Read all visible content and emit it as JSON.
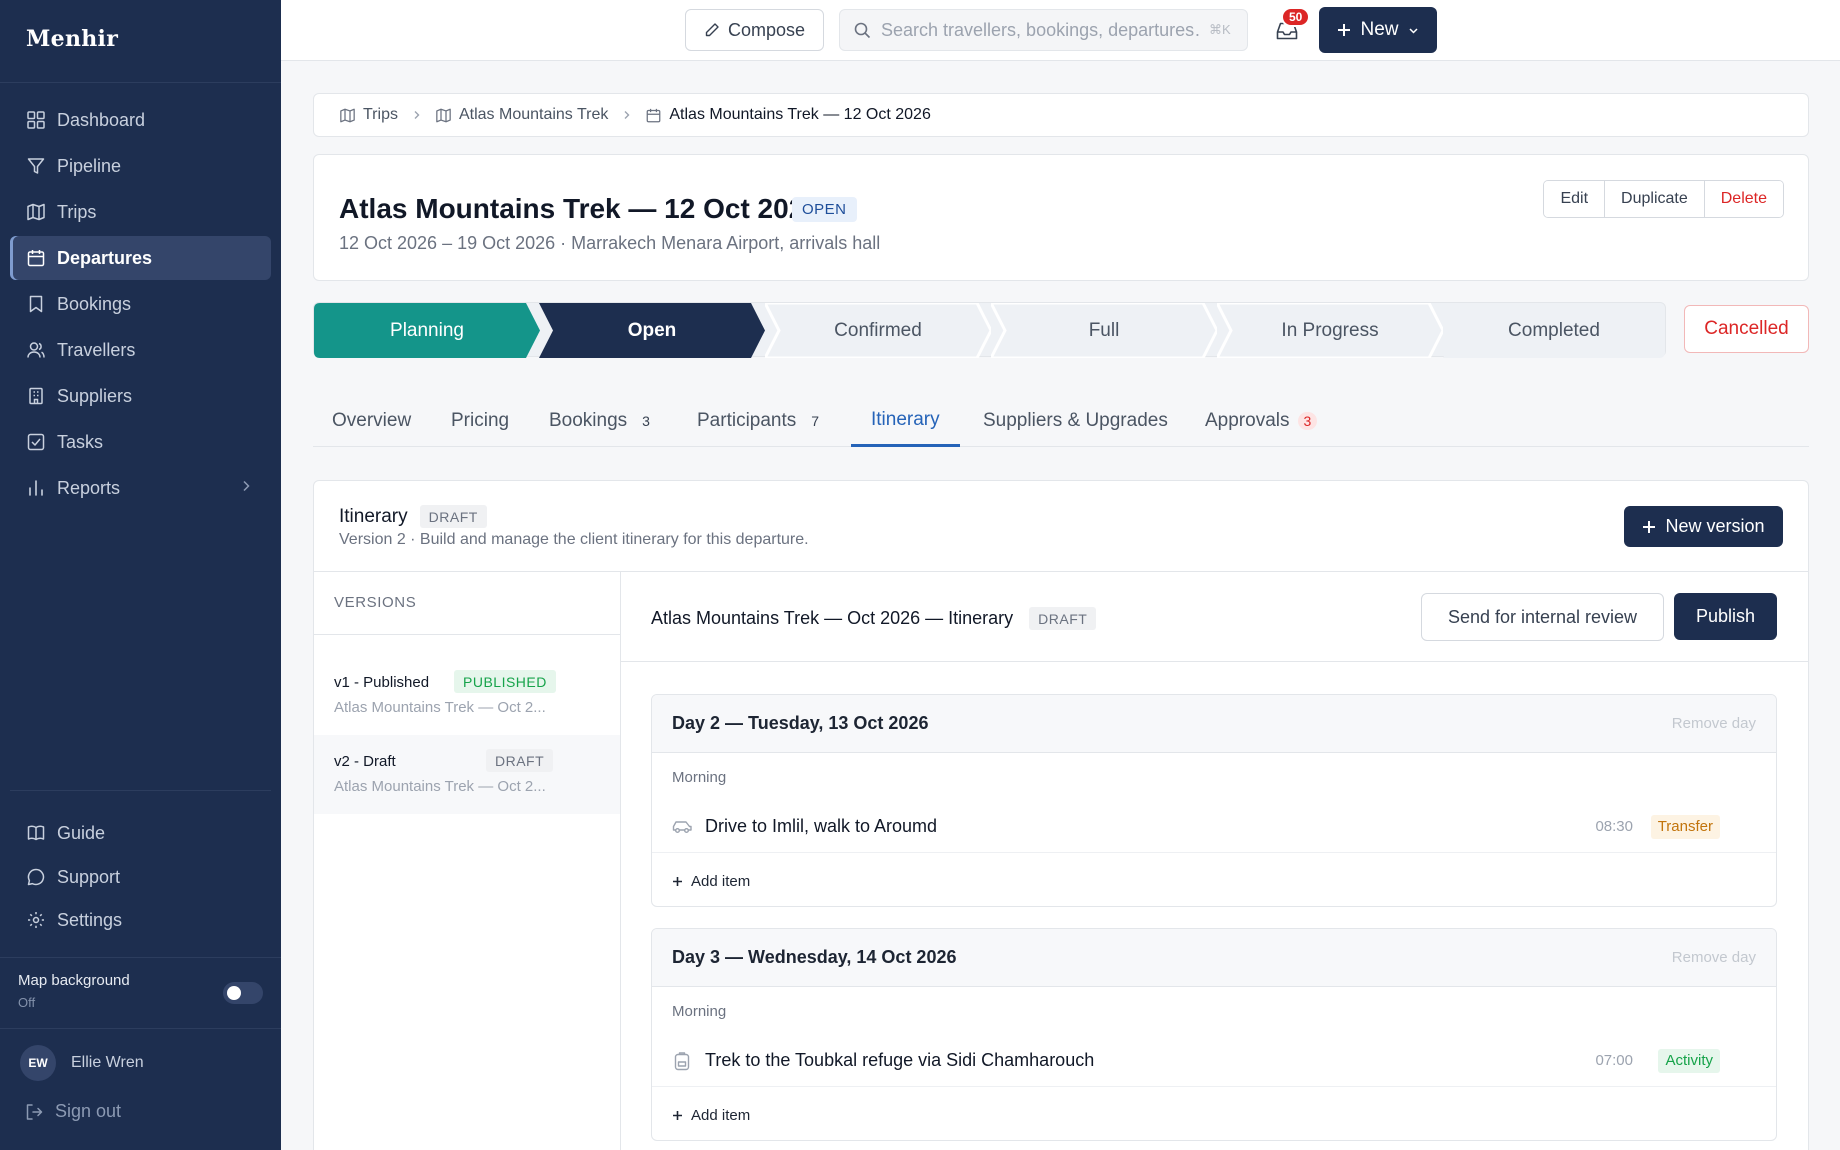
{
  "app": {
    "name": "Menhir"
  },
  "sidebar": {
    "items": [
      {
        "label": "Dashboard",
        "icon": "dashboard-icon"
      },
      {
        "label": "Pipeline",
        "icon": "filter-icon"
      },
      {
        "label": "Trips",
        "icon": "map-icon"
      },
      {
        "label": "Departures",
        "icon": "calendar-icon",
        "active": true
      },
      {
        "label": "Bookings",
        "icon": "bookmark-icon"
      },
      {
        "label": "Travellers",
        "icon": "users-icon"
      },
      {
        "label": "Suppliers",
        "icon": "building-icon"
      },
      {
        "label": "Tasks",
        "icon": "checkbox-icon"
      },
      {
        "label": "Reports",
        "icon": "bar-chart-icon"
      }
    ],
    "bottom_items": [
      {
        "label": "Guide",
        "icon": "book-icon"
      },
      {
        "label": "Support",
        "icon": "chat-icon"
      },
      {
        "label": "Settings",
        "icon": "gear-icon"
      }
    ],
    "map_background": {
      "label": "Map background",
      "state": "Off"
    },
    "user": {
      "initials": "EW",
      "name": "Ellie Wren"
    },
    "sign_out": "Sign out"
  },
  "topbar": {
    "compose": "Compose",
    "search_placeholder": "Search travellers, bookings, departures…",
    "search_shortcut": "⌘K",
    "notifications_count": "50",
    "new_label": "New"
  },
  "breadcrumb": [
    "Trips",
    "Atlas Mountains Trek",
    "Atlas Mountains Trek — 12 Oct 2026"
  ],
  "departure": {
    "title": "Atlas Mountains Trek — 12 Oct 2026",
    "status": "OPEN",
    "subtitle": "12 Oct 2026 – 19 Oct 2026 · Marrakech Menara Airport, arrivals hall",
    "actions": {
      "edit": "Edit",
      "duplicate": "Duplicate",
      "delete": "Delete"
    }
  },
  "pipeline": {
    "stages": [
      "Planning",
      "Open",
      "Confirmed",
      "Full",
      "In Progress",
      "Completed"
    ],
    "current": "Open",
    "cancelled": "Cancelled"
  },
  "tabs": [
    {
      "label": "Overview"
    },
    {
      "label": "Pricing"
    },
    {
      "label": "Bookings",
      "count": "3"
    },
    {
      "label": "Participants",
      "count": "7"
    },
    {
      "label": "Itinerary",
      "active": true
    },
    {
      "label": "Suppliers & Upgrades"
    },
    {
      "label": "Approvals",
      "count": "3"
    }
  ],
  "itinerary": {
    "title": "Itinerary",
    "status": "DRAFT",
    "subtitle": "Version 2 · Build and manage the client itinerary for this departure.",
    "new_version": "New version",
    "versions_heading": "VERSIONS",
    "versions": [
      {
        "name": "v1 - Published",
        "status": "PUBLISHED",
        "subtitle": "Atlas Mountains Trek — Oct 2..."
      },
      {
        "name": "v2 - Draft",
        "status": "DRAFT",
        "subtitle": "Atlas Mountains Trek — Oct 2..."
      }
    ],
    "document": {
      "title": "Atlas Mountains Trek — Oct 2026 — Itinerary",
      "status": "DRAFT",
      "review": "Send for internal review",
      "publish": "Publish"
    },
    "days": [
      {
        "title": "Day 2 — Tuesday, 13 Oct 2026",
        "remove": "Remove day",
        "period": "Morning",
        "item": {
          "name": "Drive to Imlil, walk to Aroumd",
          "time": "08:30",
          "tag": "Transfer",
          "icon": "car-icon"
        },
        "add_item": "Add item"
      },
      {
        "title": "Day 3 — Wednesday, 14 Oct 2026",
        "remove": "Remove day",
        "period": "Morning",
        "item": {
          "name": "Trek to the Toubkal refuge via Sidi Chamharouch",
          "time": "07:00",
          "tag": "Activity",
          "icon": "backpack-icon"
        },
        "add_item": "Add item"
      }
    ]
  },
  "colors": {
    "sidebar_bg": "#1d2e4f",
    "primary": "#1d2e4f",
    "planning_stage": "#14958a",
    "active_tab": "#2563b8",
    "danger": "#dc2626",
    "success": "#16a34a",
    "warning": "#c2740c"
  }
}
